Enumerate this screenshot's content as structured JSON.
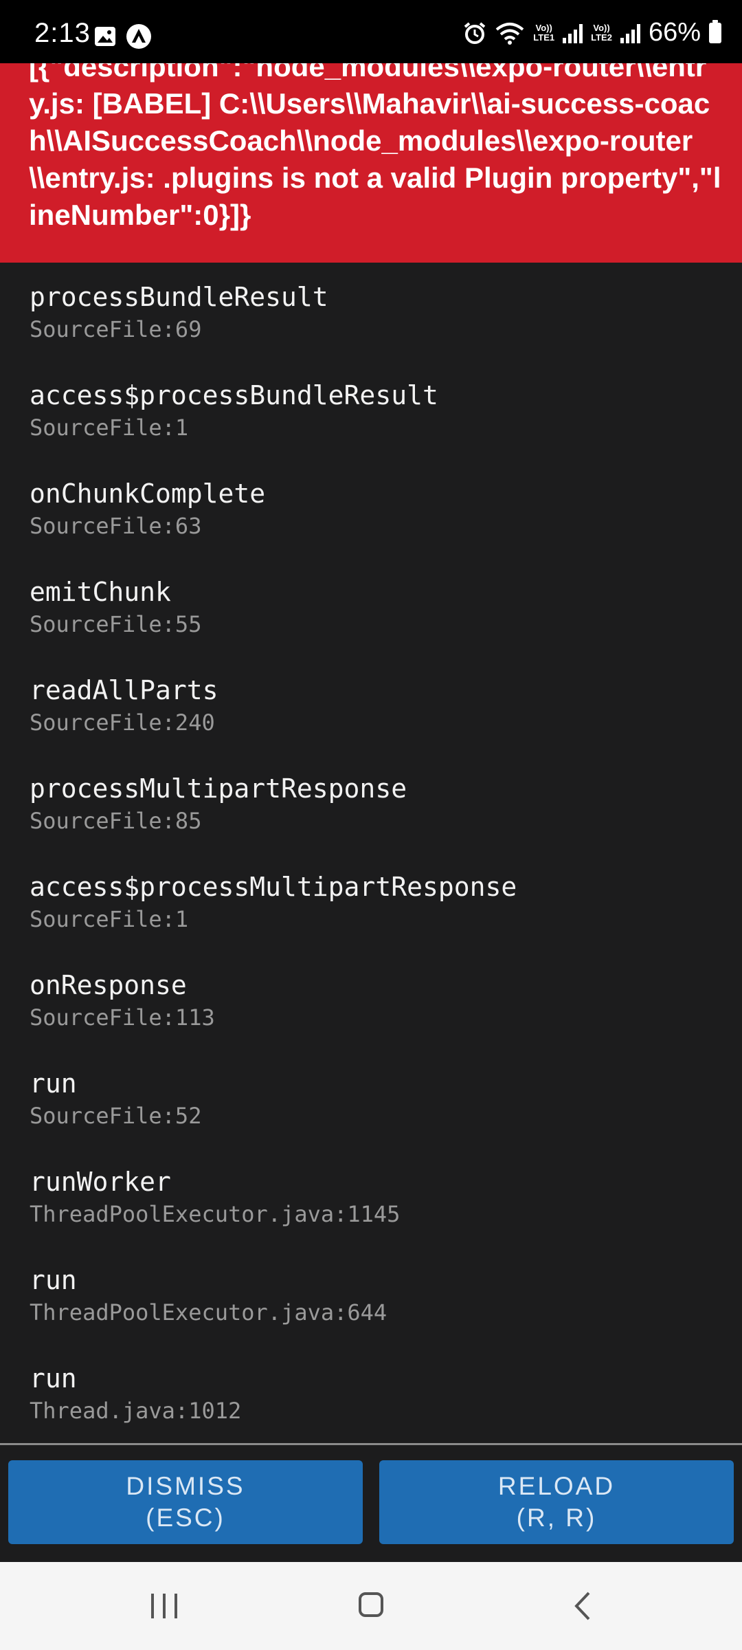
{
  "status_bar": {
    "time": "2:13",
    "left_icons": [
      "gallery-icon",
      "app-notification-icon"
    ],
    "right_icons": [
      "alarm-icon",
      "wifi-icon",
      "signal-sim1-icon",
      "signal-sim2-icon",
      "battery-icon"
    ],
    "sim1_label_top": "Vo))",
    "sim1_label_bottom": "LTE1",
    "sim2_label_top": "Vo))",
    "sim2_label_bottom": "LTE2",
    "battery": "66%"
  },
  "error": {
    "message": "[{\"description\":\"node_modules\\\\expo-router\\\\entry.js: [BABEL] C:\\\\Users\\\\Mahavir\\\\ai-success-coach\\\\AISuccessCoach\\\\node_modules\\\\expo-router\\\\entry.js: .plugins is not a valid Plugin property\",\"lineNumber\":0}]}",
    "background_color": "#d01d29"
  },
  "stack_trace": [
    {
      "method": "processBundleResult",
      "location": "SourceFile:69"
    },
    {
      "method": "access$processBundleResult",
      "location": "SourceFile:1"
    },
    {
      "method": "onChunkComplete",
      "location": "SourceFile:63"
    },
    {
      "method": "emitChunk",
      "location": "SourceFile:55"
    },
    {
      "method": "readAllParts",
      "location": "SourceFile:240"
    },
    {
      "method": "processMultipartResponse",
      "location": "SourceFile:85"
    },
    {
      "method": "access$processMultipartResponse",
      "location": "SourceFile:1"
    },
    {
      "method": "onResponse",
      "location": "SourceFile:113"
    },
    {
      "method": "run",
      "location": "SourceFile:52"
    },
    {
      "method": "runWorker",
      "location": "ThreadPoolExecutor.java:1145"
    },
    {
      "method": "run",
      "location": "ThreadPoolExecutor.java:644"
    },
    {
      "method": "run",
      "location": "Thread.java:1012"
    }
  ],
  "buttons": {
    "dismiss_line1": "DISMISS",
    "dismiss_line2": "(ESC)",
    "reload_line1": "RELOAD",
    "reload_line2": "(R, R)",
    "color": "#1f6db3"
  },
  "nav_bar": {
    "icons": [
      "recents-icon",
      "home-icon",
      "back-icon"
    ]
  }
}
